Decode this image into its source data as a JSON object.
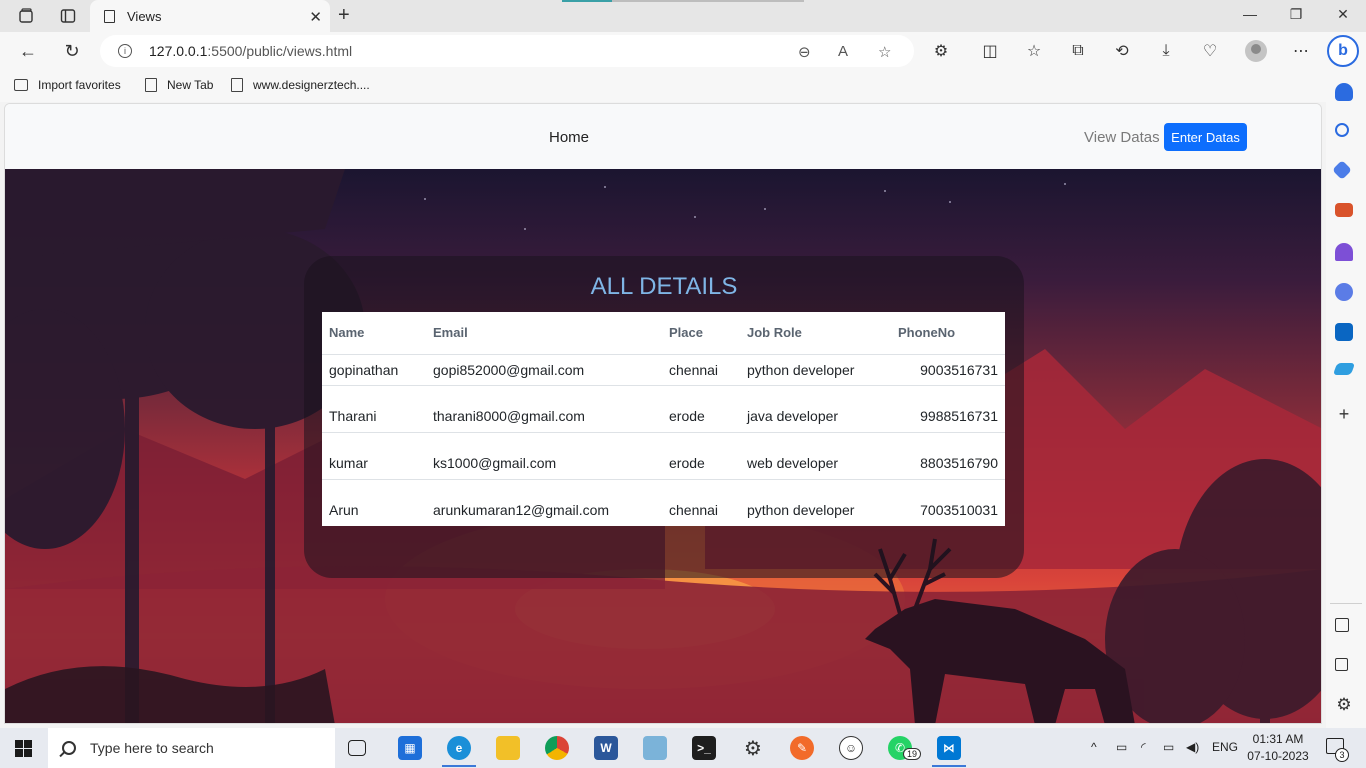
{
  "browser": {
    "tab_title": "Views",
    "url_host": "127.0.0.1",
    "url_path": ":5500/public/views.html",
    "favorites": [
      {
        "label": "Import favorites"
      },
      {
        "label": "New Tab"
      },
      {
        "label": "www.designerztech...."
      }
    ]
  },
  "site_nav": {
    "home_label": "Home",
    "view_label": "View Datas",
    "enter_label": "Enter Datas"
  },
  "card": {
    "title": "ALL DETAILS",
    "columns": [
      "Name",
      "Email",
      "Place",
      "Job Role",
      "PhoneNo"
    ],
    "rows": [
      {
        "name": "gopinathan",
        "email": "gopi852000@gmail.com",
        "place": "chennai",
        "job": "python developer",
        "phone": "9003516731"
      },
      {
        "name": "Tharani",
        "email": "tharani8000@gmail.com",
        "place": "erode",
        "job": "java developer",
        "phone": "9988516731"
      },
      {
        "name": "kumar",
        "email": "ks1000@gmail.com",
        "place": "erode",
        "job": "web developer",
        "phone": "8803516790"
      },
      {
        "name": "Arun",
        "email": "arunkumaran12@gmail.com",
        "place": "chennai",
        "job": "python developer",
        "phone": "7003510031"
      }
    ]
  },
  "taskbar": {
    "search_placeholder": "Type here to search",
    "language": "ENG",
    "time": "01:31 AM",
    "date": "07-10-2023",
    "whatsapp_badge": "19",
    "notification_count": "3"
  },
  "colors": {
    "accent_button": "#0d6efd",
    "card_title": "#7fb5e6",
    "edge_accent": "#3b78d8"
  }
}
